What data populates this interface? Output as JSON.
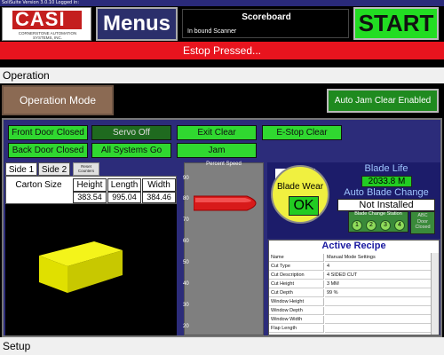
{
  "window": {
    "title": "SoliSuite Version 3.0.10 Logged in:"
  },
  "logo": {
    "text": "CASI",
    "subtitle_line1": "CORNERSTONE AUTOMATION",
    "subtitle_line2": "SYSTEMS, INC."
  },
  "header": {
    "menus_label": "Menus",
    "scoreboard_title": "Scoreboard",
    "scoreboard_status": "In bound Scanner",
    "start_label": "START"
  },
  "alarm": {
    "text": "Estop Pressed..."
  },
  "operation": {
    "section_title": "Operation",
    "mode_label": "Operation Mode",
    "auto_jam_label": "Auto Jam Clear Enabled"
  },
  "status_buttons": [
    {
      "label": "Front Door Closed"
    },
    {
      "label": "Servo Off"
    },
    {
      "label": "Exit Clear"
    },
    {
      "label": "E-Stop Clear"
    },
    {
      "label": "Back Door Closed"
    },
    {
      "label": "All Systems Go"
    },
    {
      "label": "Jam"
    }
  ],
  "tabs": [
    {
      "label": "Side 1"
    },
    {
      "label": "Side 2"
    }
  ],
  "reset_counters": {
    "line1": "Reset",
    "line2": "Counters"
  },
  "carton": {
    "label": "Carton Size",
    "headers": [
      "Height",
      "Length",
      "Width"
    ],
    "values": [
      "383.54",
      "995.04",
      "384.46"
    ]
  },
  "speed": {
    "title": "Percent Speed",
    "ticks": [
      "90",
      "80",
      "70",
      "60",
      "50",
      "40",
      "30",
      "20"
    ],
    "level_percent": 82
  },
  "blade": {
    "wear_label": "Blade Wear",
    "wear_status": "OK",
    "life_title": "Blade Life",
    "life_value": "2033.8 M",
    "abc_title": "Auto Blade Change",
    "abc_status": "Not Installed",
    "station_title": "Blade Change Station",
    "stations": [
      "1",
      "2",
      "3",
      "4"
    ],
    "door_line1": "ABC",
    "door_line2": "Door",
    "door_line3": "Closed"
  },
  "recipe": {
    "title": "Active Recipe",
    "rows": [
      {
        "k": "Name",
        "v": "Manual Mode Settings"
      },
      {
        "k": "Cut Type",
        "v": "4"
      },
      {
        "k": "Cut Description",
        "v": "4 SIDED CUT"
      },
      {
        "k": "Cut Height",
        "v": "3 MM"
      },
      {
        "k": "Cut Depth",
        "v": "99 %"
      },
      {
        "k": "Window Height",
        "v": ""
      },
      {
        "k": "Window Depth",
        "v": ""
      },
      {
        "k": "Window Width",
        "v": ""
      },
      {
        "k": "Flap Length",
        "v": ""
      }
    ]
  },
  "setup": {
    "section_title": "Setup"
  },
  "colors": {
    "alarm": "#e8141e",
    "start": "#22dd22",
    "status_green": "#30d830",
    "panel_blue": "#2c2c7a",
    "menus_blue": "#2b2f6b"
  }
}
